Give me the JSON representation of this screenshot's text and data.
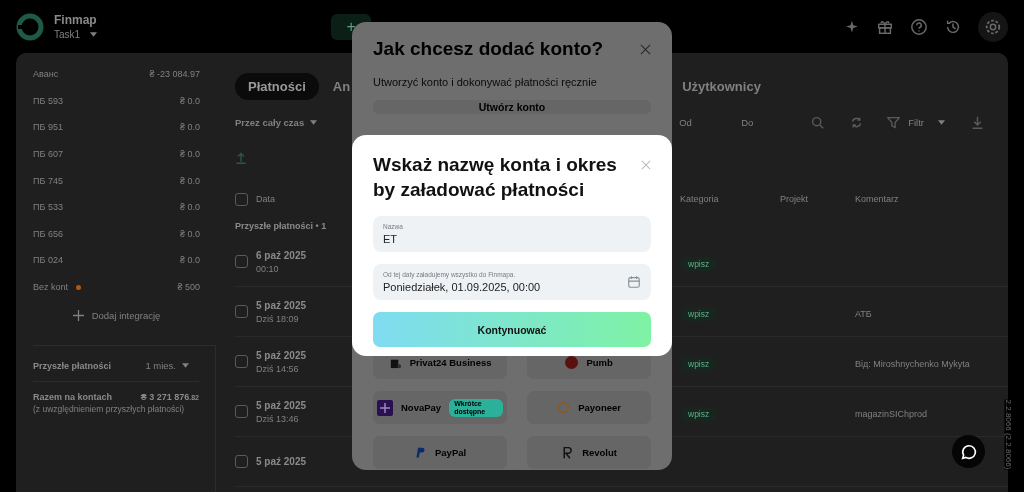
{
  "app": {
    "name": "Finmap",
    "workspace": "Task1",
    "add_button": "+"
  },
  "accounts": [
    {
      "name": "Аванс",
      "amount": "₴ -23 084.97",
      "flagged": false
    },
    {
      "name": "ПБ 593",
      "amount": "₴ 0.0",
      "flagged": false
    },
    {
      "name": "ПБ 951",
      "amount": "₴ 0.0",
      "flagged": false
    },
    {
      "name": "ПБ 607",
      "amount": "₴ 0.0",
      "flagged": false
    },
    {
      "name": "ПБ 745",
      "amount": "₴ 0.0",
      "flagged": false
    },
    {
      "name": "ПБ 533",
      "amount": "₴ 0.0",
      "flagged": false
    },
    {
      "name": "ПБ 656",
      "amount": "₴ 0.0",
      "flagged": false
    },
    {
      "name": "ПБ 024",
      "amount": "₴ 0.0",
      "flagged": false
    },
    {
      "name": "Bez kont",
      "amount": "₴ 500",
      "flagged": true
    }
  ],
  "add_integration": "Dodaj integrację",
  "future": {
    "label": "Przyszłe płatności",
    "period": "1 mies."
  },
  "total": {
    "label": "Razem na kontach",
    "amount": "₴ 3 271 876",
    "decimals": ".82",
    "note": "(z uwzględnieniem przyszłych płatności)"
  },
  "tabs": [
    {
      "label": "Płatności",
      "selected": true
    },
    {
      "label": "An",
      "selected": false
    },
    {
      "label": "Użytkownicy",
      "selected": false
    }
  ],
  "filters": {
    "period": "Przez cały czas",
    "from": "Od",
    "to": "Do",
    "filter": "Filtr"
  },
  "table": {
    "columns": [
      "Data",
      "Kategoria",
      "Projekt",
      "Komentarz"
    ],
    "select_all_checked": false,
    "group": "Przyszłe płatności • 1",
    "rows": [
      {
        "checked": false,
        "date": "6 paź 2025",
        "time": "00:10",
        "category": "wpisz"
      },
      {
        "checked": false,
        "date": "5 paź 2025",
        "time": "Dziś 18:09",
        "category": "wpisz",
        "comment": "АТБ"
      },
      {
        "checked": false,
        "date": "5 paź 2025",
        "time": "Dziś 14:56",
        "category": "wpisz",
        "comment": "Від: Miroshnychenko Mykyta"
      },
      {
        "checked": false,
        "date": "5 paź 2025",
        "time": "Dziś 13:46",
        "category": "wpisz",
        "comment": "magazinSIChprod"
      },
      {
        "checked": false,
        "date": "5 paź 2025"
      }
    ]
  },
  "version": "2.2.8066 (2.2.8066)",
  "modal_add": {
    "title": "Jak chcesz dodać konto?",
    "subtitle": "Utworzyć konto i dokonywać płatności ręcznie",
    "create_button": "Utwórz konto",
    "integrations": [
      {
        "name": "Privat24 Business"
      },
      {
        "name": "Pumb"
      },
      {
        "name": "NovaPay",
        "badge": "Wkrótce dostępne"
      },
      {
        "name": "Payoneer"
      },
      {
        "name": "PayPal"
      },
      {
        "name": "Revolut"
      }
    ]
  },
  "modal_name": {
    "title": "Wskaż nazwę konta i okres by załadować płatności",
    "name_label": "Nazwa",
    "name_value": "ET",
    "date_label": "Od tej daty załadujemy wszystko do Finmapa.",
    "date_value": "Poniedziałek, 01.09.2025, 00:00",
    "submit": "Kontynuować"
  }
}
